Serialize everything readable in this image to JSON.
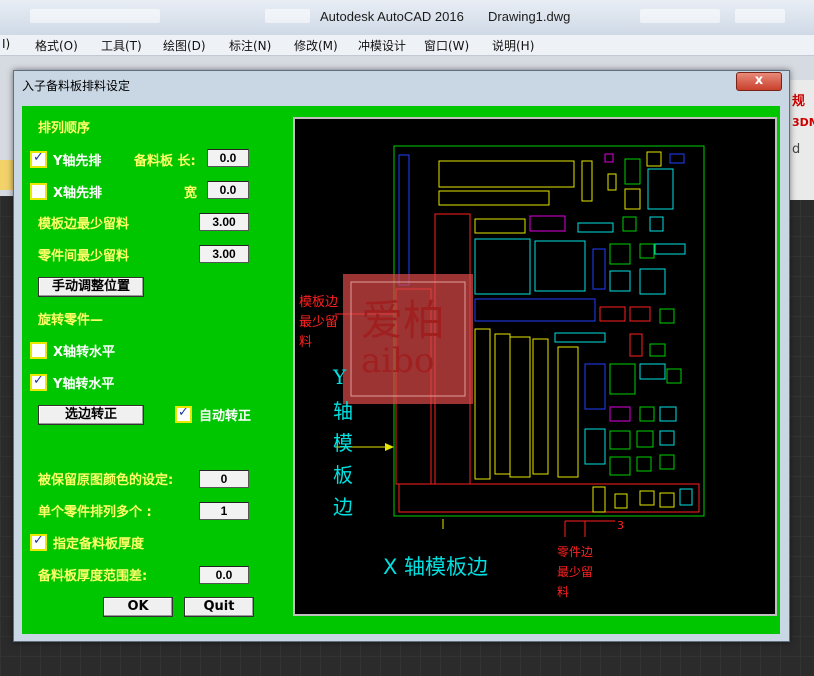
{
  "window": {
    "app_title": "Autodesk AutoCAD 2016",
    "doc_title": "Drawing1.dwg"
  },
  "menubar": {
    "items": [
      "I)",
      "格式(O)",
      "工具(T)",
      "绘图(D)",
      "标注(N)",
      "修改(M)",
      "冲模设计",
      "窗口(W)",
      "说明(H)"
    ]
  },
  "background": {
    "right_letters": [
      "规",
      "3DM",
      "d"
    ]
  },
  "dialog": {
    "title": "入子备料板排料设定",
    "close_label": "x",
    "sort_heading": "排列顺序",
    "y_first_label": "Y轴先排",
    "y_first_checked": true,
    "x_first_label": "X轴先排",
    "x_first_checked": false,
    "stock_length_label": "备料板 长:",
    "stock_length_value": "0.0",
    "stock_width_label": "宽",
    "stock_width_value": "0.0",
    "edge_margin_label": "模板边最少留料",
    "edge_margin_value": "3.00",
    "part_gap_label": "零件间最少留料",
    "part_gap_value": "3.00",
    "manual_adjust_button": "手动调整位置",
    "rotate_heading": "旋转零件—",
    "x_rotate_label": "X轴转水平",
    "x_rotate_checked": false,
    "y_rotate_label": "Y轴转水平",
    "y_rotate_checked": true,
    "select_edge_button": "选边转正",
    "auto_rotate_label": "自动转正",
    "auto_rotate_checked": true,
    "keep_color_label": "被保留原图颜色的设定:",
    "keep_color_value": "0",
    "per_part_label": "单个零件排列多个 :",
    "per_part_value": "1",
    "thickness_label": "指定备料板厚度",
    "thickness_checked": true,
    "thickness_range_label": "备料板厚度范围差:",
    "thickness_range_value": "0.0",
    "ok_button": "OK",
    "quit_button": "Quit"
  },
  "preview": {
    "watermark_cn": "爱柏",
    "watermark_en": "aibo",
    "left_note": [
      "模板边",
      "最少留",
      "料"
    ],
    "y_axis_label": [
      "Y",
      "轴",
      "模",
      "板",
      "边"
    ],
    "x_axis_label": "X 轴模板边",
    "bottom_note": [
      "零件边",
      "最少留",
      "料"
    ],
    "dimension_text": "3"
  },
  "colors": {
    "dialog_bg": "#00c600",
    "label_yellow": "#ffff66",
    "cad_red": "#ff2020",
    "cad_yellow": "#e6e600",
    "cad_cyan": "#00e0e0",
    "cad_green": "#00d000",
    "cad_blue": "#2040ff",
    "cad_magenta": "#e000e0",
    "watermark": "#d84848"
  }
}
